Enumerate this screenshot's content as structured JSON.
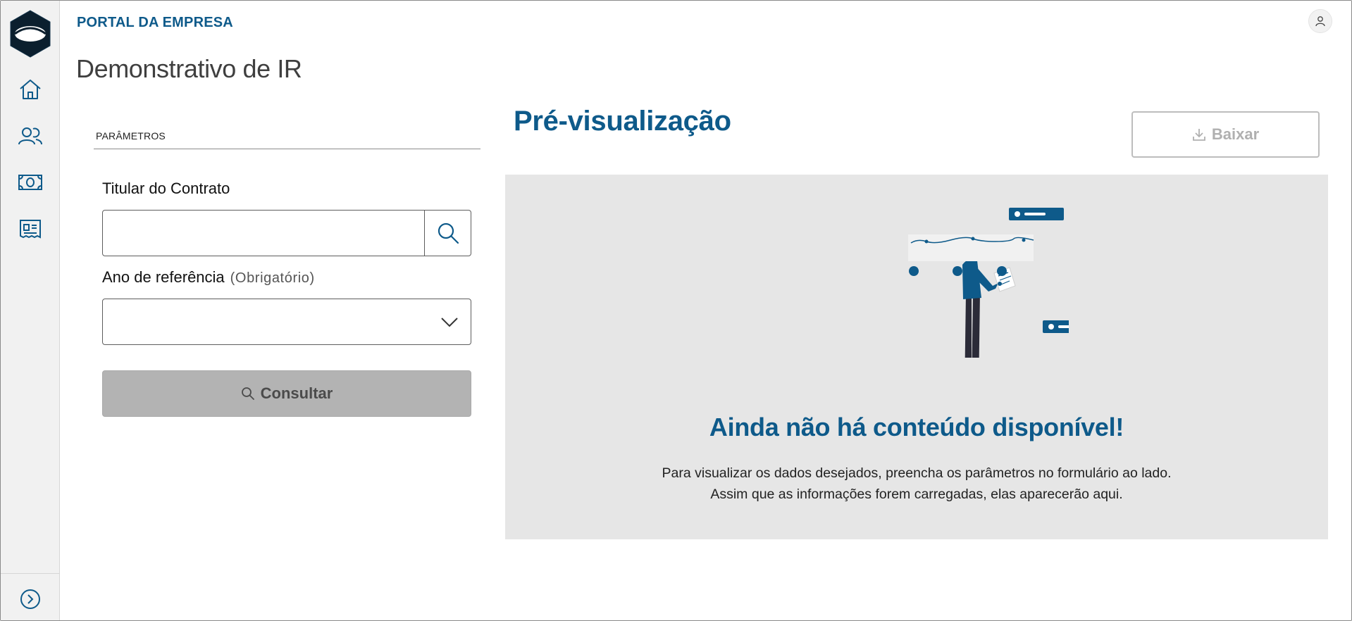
{
  "header": {
    "portal_title": "PORTAL DA EMPRESA",
    "page_title": "Demonstrativo de IR"
  },
  "sidebar": {
    "items": [
      {
        "icon": "home-icon"
      },
      {
        "icon": "users-icon"
      },
      {
        "icon": "money-icon"
      },
      {
        "icon": "receipt-icon"
      }
    ],
    "footer_icon": "chevron-right-circle-icon"
  },
  "form": {
    "section_label": "PARÂMETROS",
    "contract_holder": {
      "label": "Titular do Contrato",
      "value": "",
      "placeholder": ""
    },
    "reference_year": {
      "label": "Ano de referência",
      "hint": "(Obrigatório)",
      "selected": ""
    },
    "submit_label": "Consultar"
  },
  "preview": {
    "title": "Pré-visualização",
    "download_label": "Baixar",
    "empty_title": "Ainda não há conteúdo disponível!",
    "empty_description": "Para visualizar os dados desejados, preencha os parâmetros no formulário ao lado. Assim que as informações forem carregadas, elas aparecerão aqui."
  },
  "colors": {
    "brand": "#0e5a8a",
    "sidebar_bg": "#f1f1f1",
    "preview_bg": "#e6e6e6",
    "disabled_button": "#b3b3b3"
  }
}
